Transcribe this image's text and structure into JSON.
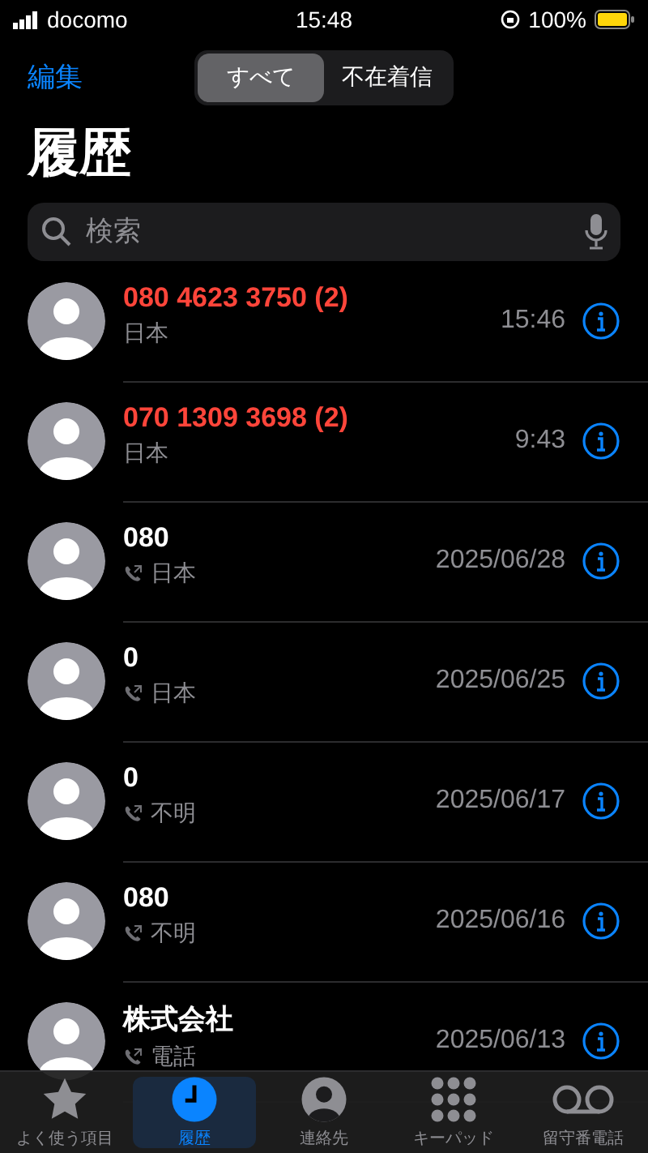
{
  "status_bar": {
    "carrier": "docomo",
    "time": "15:48",
    "battery": "100%"
  },
  "header": {
    "edit": "編集",
    "segments": [
      {
        "label": "すべて",
        "selected": true
      },
      {
        "label": "不在着信",
        "selected": false
      }
    ]
  },
  "title": "履歴",
  "search": {
    "placeholder": "検索"
  },
  "calls": [
    {
      "kind": "missed",
      "name": "080 4623 3750 (2)",
      "label": "日本",
      "time": "15:46"
    },
    {
      "kind": "missed",
      "name": "070 1309 3698 (2)",
      "label": "日本",
      "time": "9:43"
    },
    {
      "kind": "outgoing",
      "name": "080",
      "label": "日本",
      "time": "2025/06/28"
    },
    {
      "kind": "outgoing",
      "name": "0",
      "label": "日本",
      "time": "2025/06/25"
    },
    {
      "kind": "outgoing",
      "name": "0",
      "label": "不明",
      "time": "2025/06/17"
    },
    {
      "kind": "outgoing",
      "name": "080",
      "label": "不明",
      "time": "2025/06/16"
    },
    {
      "kind": "outgoing",
      "name": "株式会社",
      "label": "電話",
      "time": "2025/06/13"
    }
  ],
  "tab_bar": [
    {
      "kind": "favorites",
      "label": "よく使う項目",
      "selected": false
    },
    {
      "kind": "recents",
      "label": "履歴",
      "selected": true
    },
    {
      "kind": "contacts",
      "label": "連絡先",
      "selected": false
    },
    {
      "kind": "keypad",
      "label": "キーパッド",
      "selected": false
    },
    {
      "kind": "voicemail",
      "label": "留守番電話",
      "selected": false
    }
  ]
}
